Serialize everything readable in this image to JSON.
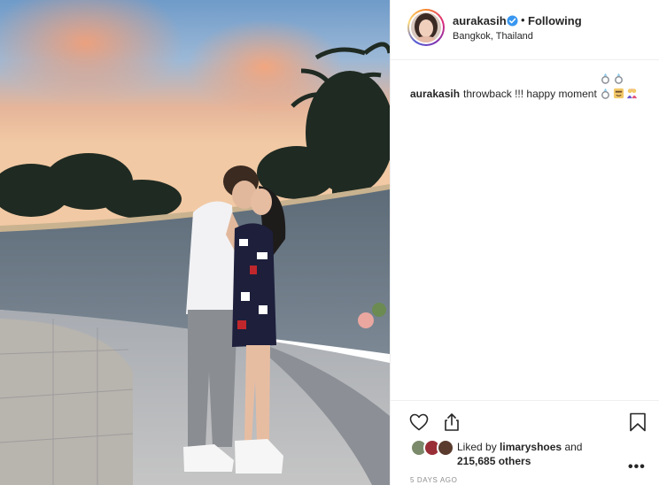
{
  "post": {
    "username": "aurakasih",
    "follow_status": "Following",
    "location": "Bangkok, Thailand",
    "caption_user": "aurakasih",
    "caption_text": "throwback !!! happy moment",
    "caption_emojis": [
      "ring-emoji",
      "ring-emoji",
      "ring-emoji",
      "smiling-emoji",
      "couple-kiss-emoji"
    ],
    "liked_by_prefix": "Liked by",
    "liked_by_user": "limaryshoes",
    "liked_by_and": "and",
    "likes_others": "215,685 others",
    "timestamp": "5 DAYS AGO"
  },
  "icons": {
    "verified": "verified-badge-icon",
    "heart": "heart-icon",
    "share": "share-icon",
    "bookmark": "bookmark-icon",
    "more": "more-options-icon"
  },
  "colors": {
    "verified_blue": "#3897f0",
    "text": "#262626",
    "muted": "#8e8e8e",
    "border": "#efefef"
  }
}
